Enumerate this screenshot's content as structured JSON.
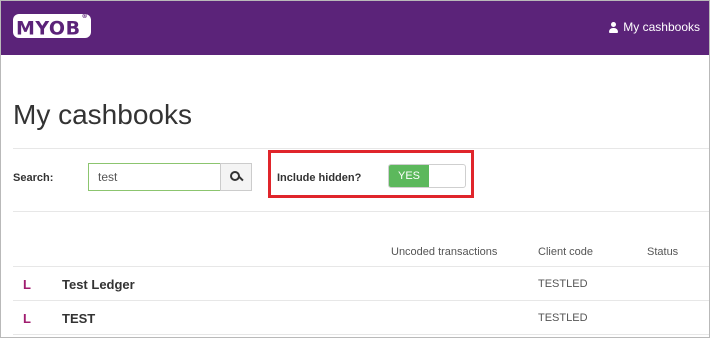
{
  "header": {
    "logo_text": "MYOB",
    "logo_mark": "®",
    "user_link_label": "My cashbooks",
    "bar_color": "#5b2379"
  },
  "page": {
    "title": "My cashbooks"
  },
  "search": {
    "label": "Search:",
    "value": "test"
  },
  "include_hidden": {
    "label": "Include hidden?",
    "toggle_value": "YES",
    "toggle_color": "#5cb85c",
    "highlight_color": "#e0252b"
  },
  "table": {
    "columns": [
      "Uncoded transactions",
      "Client code",
      "Status"
    ],
    "rows": [
      {
        "type": "L",
        "name": "Test Ledger",
        "uncoded": "",
        "client_code": "TESTLED",
        "status": ""
      },
      {
        "type": "L",
        "name": "TEST",
        "uncoded": "",
        "client_code": "TESTLED",
        "status": ""
      }
    ]
  }
}
